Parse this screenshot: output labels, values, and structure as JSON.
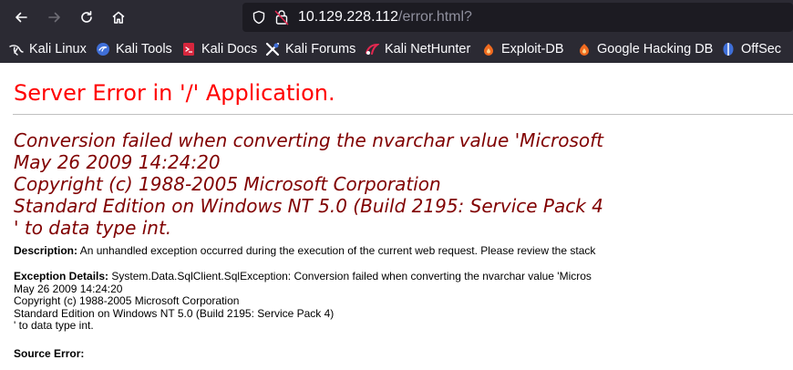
{
  "browser": {
    "url_host": "10.129.228.112",
    "url_path": "/error.html?",
    "bookmarks": [
      {
        "label": "Kali Linux",
        "icon": "kali-dragon-icon"
      },
      {
        "label": "Kali Tools",
        "icon": "kali-tools-icon"
      },
      {
        "label": "Kali Docs",
        "icon": "kali-docs-icon"
      },
      {
        "label": "Kali Forums",
        "icon": "kali-forums-icon"
      },
      {
        "label": "Kali NetHunter",
        "icon": "kali-nethunter-icon"
      },
      {
        "label": "Exploit-DB",
        "icon": "exploit-db-icon"
      },
      {
        "label": "Google Hacking DB",
        "icon": "ghdb-icon"
      },
      {
        "label": "OffSec",
        "icon": "offsec-icon"
      }
    ]
  },
  "page": {
    "title": "Server Error in '/' Application.",
    "headline_lines": [
      "Conversion failed when converting the nvarchar value 'Microsoft",
      "May 26 2009 14:24:20",
      "Copyright (c) 1988-2005 Microsoft Corporation",
      "Standard Edition on Windows NT 5.0 (Build 2195: Service Pack 4",
      "' to data type int."
    ],
    "description_label": "Description:",
    "description_text": " An unhandled exception occurred during the execution of the current web request. Please review the stack",
    "exception_label": "Exception Details:",
    "exception_lines": [
      " System.Data.SqlClient.SqlException: Conversion failed when converting the nvarchar value 'Micros",
      "May 26 2009 14:24:20",
      "Copyright (c) 1988-2005 Microsoft Corporation",
      "Standard Edition on Windows NT 5.0 (Build 2195: Service Pack 4)",
      "' to data type int."
    ],
    "source_error_label": "Source Error:"
  },
  "colors": {
    "chrome_bg": "#2b2a33",
    "urlbar_bg": "#1c1b22",
    "title_red": "#ff0000",
    "headline_maroon": "#800000"
  }
}
